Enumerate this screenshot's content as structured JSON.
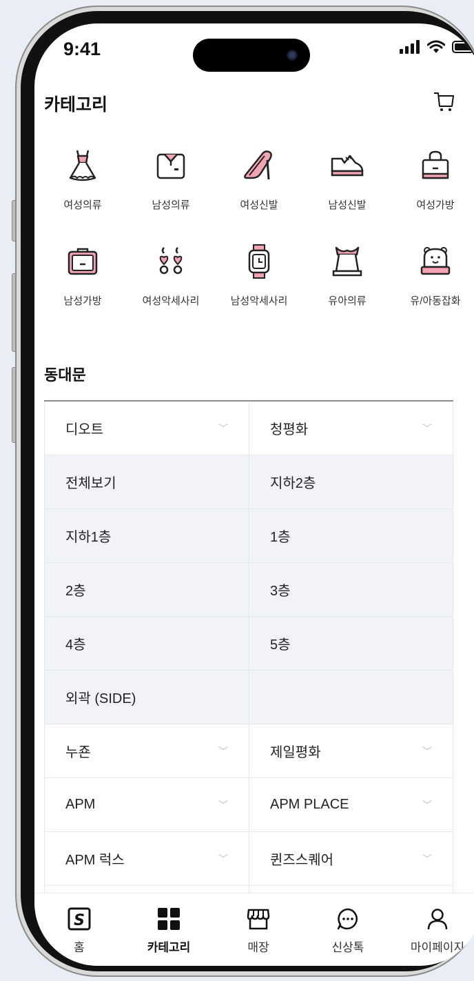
{
  "status": {
    "time": "9:41"
  },
  "header": {
    "title": "카테고리"
  },
  "categories": [
    {
      "label": "여성의류",
      "icon": "dress-icon"
    },
    {
      "label": "남성의류",
      "icon": "shirt-icon"
    },
    {
      "label": "여성신발",
      "icon": "heel-icon"
    },
    {
      "label": "남성신발",
      "icon": "sneaker-icon"
    },
    {
      "label": "여성가방",
      "icon": "handbag-icon"
    },
    {
      "label": "남성가방",
      "icon": "briefcase-icon"
    },
    {
      "label": "여성악세사리",
      "icon": "earring-icon"
    },
    {
      "label": "남성악세사리",
      "icon": "watch-icon"
    },
    {
      "label": "유아의류",
      "icon": "baby-clothes-icon"
    },
    {
      "label": "유/아동잡화",
      "icon": "kids-goods-icon"
    }
  ],
  "section": {
    "title": "동대문"
  },
  "table": {
    "rows": [
      {
        "type": "market",
        "left": "디오트",
        "right": "청평화"
      },
      {
        "type": "sub",
        "left": "전체보기",
        "right": "지하2층"
      },
      {
        "type": "sub",
        "left": "지하1층",
        "right": "1층"
      },
      {
        "type": "sub",
        "left": "2층",
        "right": "3층"
      },
      {
        "type": "sub",
        "left": "4층",
        "right": "5층"
      },
      {
        "type": "sub",
        "left": "외곽 (SIDE)",
        "right": ""
      },
      {
        "type": "market",
        "left": "누죤",
        "right": "제일평화"
      },
      {
        "type": "market",
        "left": "APM",
        "right": "APM PLACE"
      },
      {
        "type": "market",
        "left": "APM 럭스",
        "right": "퀸즈스퀘어"
      }
    ]
  },
  "tabs": [
    {
      "label": "홈",
      "icon": "home-logo-icon"
    },
    {
      "label": "카테고리",
      "icon": "grid-icon",
      "active": true
    },
    {
      "label": "매장",
      "icon": "store-icon"
    },
    {
      "label": "신상톡",
      "icon": "chat-icon"
    },
    {
      "label": "마이페이지",
      "icon": "person-icon"
    }
  ],
  "colors": {
    "accent_pink": "#f4a3b2",
    "text": "#111111",
    "sub_row_bg": "#f1f3f8"
  }
}
